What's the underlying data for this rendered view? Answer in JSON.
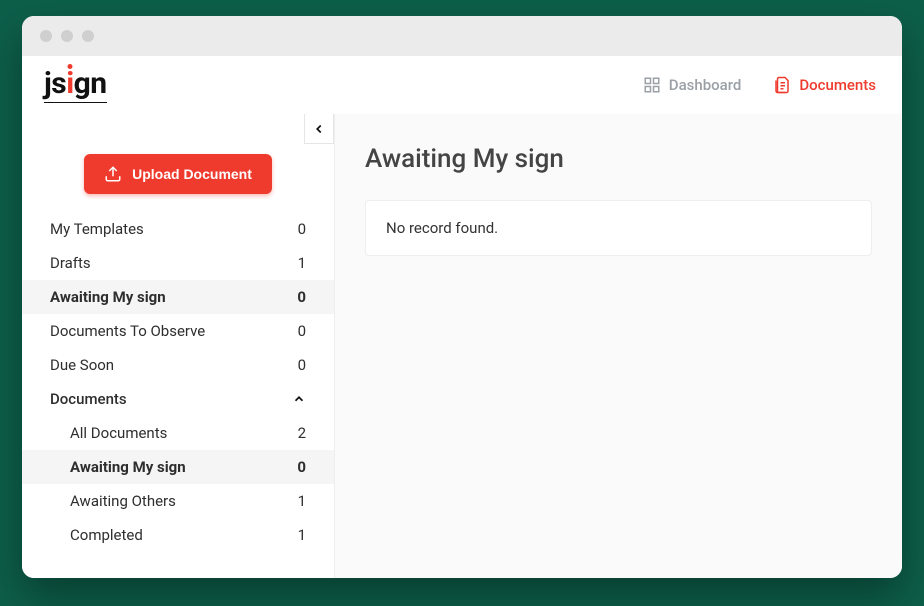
{
  "logo": {
    "pre": "js",
    "accent": "i",
    "post": "gn"
  },
  "nav": {
    "dashboard": "Dashboard",
    "documents": "Documents"
  },
  "sidebar": {
    "upload_label": "Upload Document",
    "items": [
      {
        "label": "My Templates",
        "count": "0"
      },
      {
        "label": "Drafts",
        "count": "1"
      },
      {
        "label": "Awaiting My sign",
        "count": "0"
      },
      {
        "label": "Documents To Observe",
        "count": "0"
      },
      {
        "label": "Due Soon",
        "count": "0"
      }
    ],
    "documents_parent": {
      "label": "Documents"
    },
    "sub_items": [
      {
        "label": "All Documents",
        "count": "2"
      },
      {
        "label": "Awaiting My sign",
        "count": "0"
      },
      {
        "label": "Awaiting Others",
        "count": "1"
      },
      {
        "label": "Completed",
        "count": "1"
      }
    ]
  },
  "main": {
    "title": "Awaiting My sign",
    "empty_message": "No record found."
  }
}
